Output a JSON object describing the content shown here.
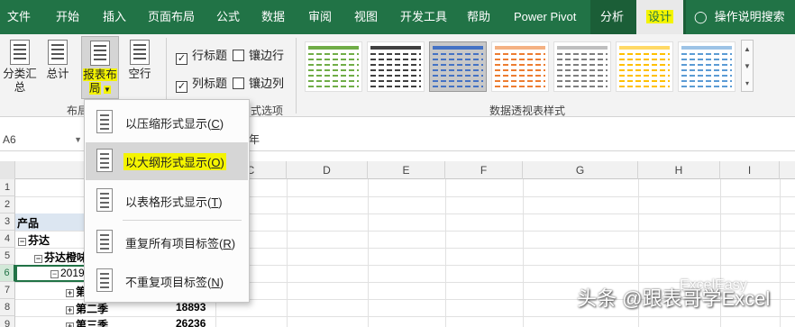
{
  "tabs": [
    "文件",
    "开始",
    "插入",
    "页面布局",
    "公式",
    "数据",
    "审阅",
    "视图",
    "开发工具",
    "帮助",
    "Power Pivot",
    "分析",
    "设计"
  ],
  "active_tab": "设计",
  "tell_me": "操作说明搜索",
  "ribbon": {
    "subtotal_label": "分类汇\n总",
    "grandtotal_label": "总计",
    "report_layout_label": "报表布\n局",
    "blank_rows_label": "空行",
    "row_headers": "行标题",
    "col_headers": "列标题",
    "banded_rows": "镶边行",
    "banded_cols": "镶边列",
    "group_layout": "布局",
    "group_options_partial": "式选项",
    "group_styles": "数据透视表样式"
  },
  "gallery_colors": [
    {
      "line": "#70ad47",
      "head": "#70ad47"
    },
    {
      "line": "#404040",
      "head": "#404040"
    },
    {
      "line": "#4472c4",
      "head": "#4472c4"
    },
    {
      "line": "#ed7d31",
      "head": "#f4b183"
    },
    {
      "line": "#7f7f7f",
      "head": "#bfbfbf"
    },
    {
      "line": "#ffc000",
      "head": "#ffd966"
    },
    {
      "line": "#5b9bd5",
      "head": "#9dc3e6"
    }
  ],
  "namebox": "A6",
  "formula_value": "年",
  "columns": [
    "C",
    "D",
    "E",
    "F",
    "G",
    "H",
    "I"
  ],
  "rows": [
    "1",
    "2",
    "3",
    "4",
    "5",
    "6",
    "7",
    "8",
    "9"
  ],
  "cells": {
    "header": "产品",
    "r4": "芬达",
    "r5": "芬达橙味",
    "r6": "2019",
    "r7": "第",
    "r8_label": "第二季",
    "r8_value": "18893",
    "r9_label": "第三季",
    "r9_value": "26236"
  },
  "menu": {
    "items": [
      {
        "text": "以压缩形式显示(",
        "key": "C",
        "end": ")"
      },
      {
        "text": "以大纲形式显示(",
        "key": "O",
        "end": ")"
      },
      {
        "text": "以表格形式显示(",
        "key": "T",
        "end": ")"
      },
      {
        "text": "重复所有项目标签(",
        "key": "R",
        "end": ")"
      },
      {
        "text": "不重复项目标签(",
        "key": "N",
        "end": ")"
      }
    ]
  },
  "watermark": "头条 @跟表哥学Excel",
  "watermark2": "ExcelEasy"
}
